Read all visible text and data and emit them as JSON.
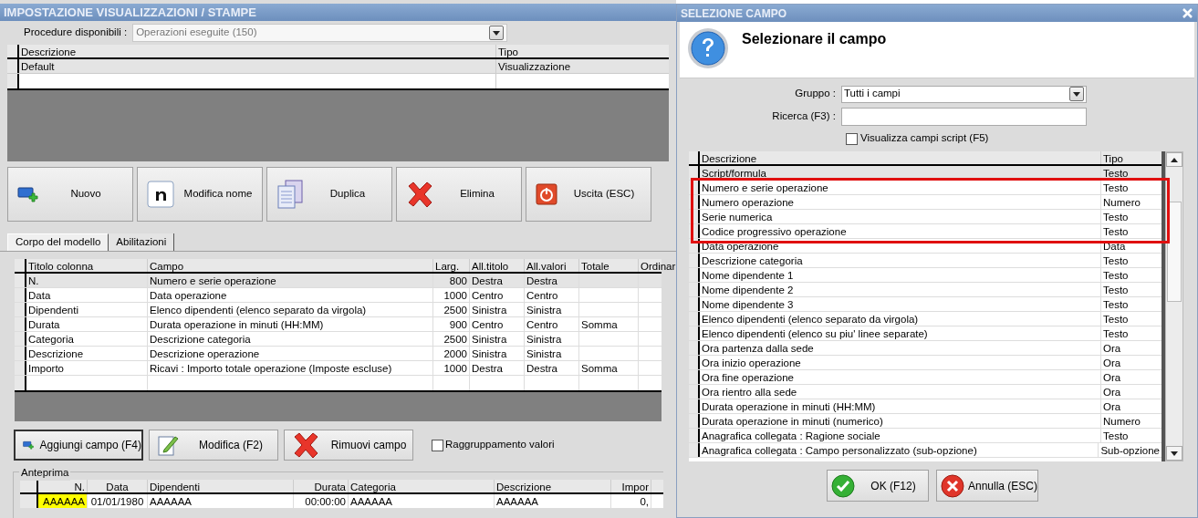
{
  "main_window": {
    "title": "IMPOSTAZIONE VISUALIZZAZIONI / STAMPE",
    "procedure": {
      "label": "Procedure disponibili :",
      "value": "Operazioni eseguite (150)"
    },
    "models_table": {
      "columns": [
        "Descrizione",
        "Tipo"
      ],
      "rows": [
        {
          "cells": [
            "Default",
            "Visualizzazione"
          ],
          "selected": true
        }
      ]
    },
    "buttons": [
      {
        "label": "Nuovo",
        "kind": "new"
      },
      {
        "label": "Modifica nome",
        "kind": "rename"
      },
      {
        "label": "Duplica",
        "kind": "duplicate"
      },
      {
        "label": "Elimina",
        "kind": "delete"
      },
      {
        "label": "Uscita (ESC)",
        "kind": "exit"
      }
    ],
    "tabs": [
      {
        "label": "Corpo del modello",
        "selected": true
      },
      {
        "label": "Abilitazioni",
        "selected": false
      }
    ],
    "columns_table": {
      "columns": [
        "Titolo colonna",
        "Campo",
        "Larg.",
        "All.titolo",
        "All.valori",
        "Totale",
        "Ordinar"
      ],
      "rows": [
        {
          "cells": [
            "N.",
            "Numero e serie operazione",
            "800",
            "Destra",
            "Destra",
            ""
          ],
          "selected": true
        },
        {
          "cells": [
            "Data",
            "Data operazione",
            "1000",
            "Centro",
            "Centro",
            ""
          ],
          "selected": false
        },
        {
          "cells": [
            "Dipendenti",
            "Elenco dipendenti (elenco separato da virgola)",
            "2500",
            "Sinistra",
            "Sinistra",
            ""
          ],
          "selected": false
        },
        {
          "cells": [
            "Durata",
            "Durata operazione in minuti (HH:MM)",
            "900",
            "Centro",
            "Centro",
            "Somma"
          ],
          "selected": false
        },
        {
          "cells": [
            "Categoria",
            "Descrizione categoria",
            "2500",
            "Sinistra",
            "Sinistra",
            ""
          ],
          "selected": false
        },
        {
          "cells": [
            "Descrizione",
            "Descrizione operazione",
            "2000",
            "Sinistra",
            "Sinistra",
            ""
          ],
          "selected": false
        },
        {
          "cells": [
            "Importo",
            "Ricavi : Importo totale operazione (Imposte escluse)",
            "1000",
            "Destra",
            "Destra",
            "Somma"
          ],
          "selected": false
        }
      ]
    },
    "column_buttons": [
      {
        "label": "Aggiungi campo (F4)",
        "kind": "add",
        "focused": true
      },
      {
        "label": "Modifica (F2)",
        "kind": "edit",
        "focused": false
      },
      {
        "label": "Rimuovi campo",
        "kind": "remove",
        "focused": false
      }
    ],
    "grouping": {
      "label": "Raggruppamento valori",
      "checked": false
    },
    "preview": {
      "title": "Anteprima",
      "columns": [
        "N.",
        "Data",
        "Dipendenti",
        "Durata",
        "Categoria",
        "Descrizione",
        "Impor"
      ],
      "rows": [
        {
          "cells": [
            "AAAAAA",
            "01/01/1980",
            "AAAAAA",
            "00:00:00",
            "AAAAAA",
            "AAAAAA",
            "0,"
          ]
        }
      ]
    }
  },
  "dialog": {
    "title": "SELEZIONE CAMPO",
    "heading": "Selezionare il campo",
    "group": {
      "label": "Gruppo :",
      "value": "Tutti i campi"
    },
    "search": {
      "label": "Ricerca (F3) :"
    },
    "script_fields": {
      "label": "Visualizza campi script (F5)",
      "checked": false
    },
    "fields_table": {
      "columns": [
        "Descrizione",
        "Tipo"
      ],
      "rows": [
        {
          "cells": [
            "Script/formula",
            "Testo"
          ],
          "selected": true,
          "highlighted": false
        },
        {
          "cells": [
            "Numero e serie operazione",
            "Testo"
          ],
          "selected": false,
          "highlighted": true
        },
        {
          "cells": [
            "Numero operazione",
            "Numero"
          ],
          "selected": false,
          "highlighted": true
        },
        {
          "cells": [
            "Serie numerica",
            "Testo"
          ],
          "selected": false,
          "highlighted": true
        },
        {
          "cells": [
            "Codice progressivo operazione",
            "Testo"
          ],
          "selected": false,
          "highlighted": true
        },
        {
          "cells": [
            "Data operazione",
            "Data"
          ],
          "selected": false,
          "highlighted": false
        },
        {
          "cells": [
            "Descrizione categoria",
            "Testo"
          ],
          "selected": false,
          "highlighted": false
        },
        {
          "cells": [
            "Nome dipendente 1",
            "Testo"
          ],
          "selected": false,
          "highlighted": false
        },
        {
          "cells": [
            "Nome dipendente 2",
            "Testo"
          ],
          "selected": false,
          "highlighted": false
        },
        {
          "cells": [
            "Nome dipendente 3",
            "Testo"
          ],
          "selected": false,
          "highlighted": false
        },
        {
          "cells": [
            "Elenco dipendenti (elenco separato da virgola)",
            "Testo"
          ],
          "selected": false,
          "highlighted": false
        },
        {
          "cells": [
            "Elenco dipendenti (elenco su piu' linee separate)",
            "Testo"
          ],
          "selected": false,
          "highlighted": false
        },
        {
          "cells": [
            "Ora partenza dalla sede",
            "Ora"
          ],
          "selected": false,
          "highlighted": false
        },
        {
          "cells": [
            "Ora inizio operazione",
            "Ora"
          ],
          "selected": false,
          "highlighted": false
        },
        {
          "cells": [
            "Ora fine operazione",
            "Ora"
          ],
          "selected": false,
          "highlighted": false
        },
        {
          "cells": [
            "Ora rientro alla sede",
            "Ora"
          ],
          "selected": false,
          "highlighted": false
        },
        {
          "cells": [
            "Durata operazione in minuti (HH:MM)",
            "Ora"
          ],
          "selected": false,
          "highlighted": false
        },
        {
          "cells": [
            "Durata operazione in minuti (numerico)",
            "Numero"
          ],
          "selected": false,
          "highlighted": false
        },
        {
          "cells": [
            "Anagrafica collegata : Ragione sociale",
            "Testo"
          ],
          "selected": false,
          "highlighted": false
        },
        {
          "cells": [
            "Anagrafica collegata : Campo personalizzato (sub-opzione)",
            "Sub-opzione"
          ],
          "selected": false,
          "highlighted": false
        }
      ]
    },
    "buttons": [
      {
        "label": "OK (F12)",
        "kind": "ok"
      },
      {
        "label": "Annulla (ESC)",
        "kind": "cancel"
      }
    ]
  }
}
